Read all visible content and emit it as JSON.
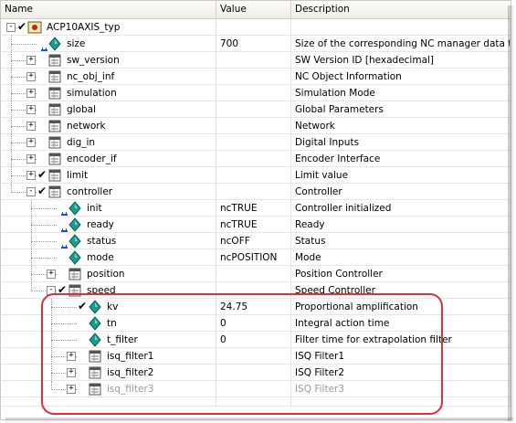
{
  "columns": {
    "name": "Name",
    "value": "Value",
    "description": "Description"
  },
  "colors": {
    "highlight": "#d8323c",
    "lock": "#1b54c8",
    "var": "#1a9c8e"
  },
  "rows": [
    {
      "level": 0,
      "name": "ACP10AXIS_typ",
      "value": "",
      "desc": "",
      "expander": "-",
      "check": true,
      "icon": "struct-check-icon",
      "lock": false
    },
    {
      "level": 1,
      "name": "size",
      "value": "700",
      "desc": "Size of the corresponding NC manager data type",
      "expander": "",
      "check": false,
      "icon": "variable-icon",
      "lock": true
    },
    {
      "level": 1,
      "name": "sw_version",
      "value": "",
      "desc": "SW Version ID [hexadecimal]",
      "expander": "+",
      "check": false,
      "icon": "struct-icon",
      "lock": false
    },
    {
      "level": 1,
      "name": "nc_obj_inf",
      "value": "",
      "desc": "NC Object Information",
      "expander": "+",
      "check": false,
      "icon": "struct-icon",
      "lock": false
    },
    {
      "level": 1,
      "name": "simulation",
      "value": "",
      "desc": "Simulation Mode",
      "expander": "+",
      "check": false,
      "icon": "struct-icon",
      "lock": false
    },
    {
      "level": 1,
      "name": "global",
      "value": "",
      "desc": "Global Parameters",
      "expander": "+",
      "check": false,
      "icon": "struct-icon",
      "lock": false
    },
    {
      "level": 1,
      "name": "network",
      "value": "",
      "desc": "Network",
      "expander": "+",
      "check": false,
      "icon": "struct-icon",
      "lock": false
    },
    {
      "level": 1,
      "name": "dig_in",
      "value": "",
      "desc": "Digital Inputs",
      "expander": "+",
      "check": false,
      "icon": "struct-icon",
      "lock": false
    },
    {
      "level": 1,
      "name": "encoder_if",
      "value": "",
      "desc": "Encoder Interface",
      "expander": "+",
      "check": false,
      "icon": "struct-icon",
      "lock": false
    },
    {
      "level": 1,
      "name": "limit",
      "value": "",
      "desc": "Limit value",
      "expander": "+",
      "check": true,
      "icon": "struct-icon",
      "lock": false
    },
    {
      "level": 1,
      "name": "controller",
      "value": "",
      "desc": "Controller",
      "expander": "-",
      "check": true,
      "icon": "struct-icon",
      "lock": false
    },
    {
      "level": 2,
      "name": "init",
      "value": "ncTRUE",
      "desc": "Controller initialized",
      "expander": "",
      "check": false,
      "icon": "variable-icon",
      "lock": true
    },
    {
      "level": 2,
      "name": "ready",
      "value": "ncTRUE",
      "desc": "Ready",
      "expander": "",
      "check": false,
      "icon": "variable-icon",
      "lock": true
    },
    {
      "level": 2,
      "name": "status",
      "value": "ncOFF",
      "desc": "Status",
      "expander": "",
      "check": false,
      "icon": "variable-icon",
      "lock": true
    },
    {
      "level": 2,
      "name": "mode",
      "value": "ncPOSITION",
      "desc": "Mode",
      "expander": "",
      "check": false,
      "icon": "variable-icon",
      "lock": false
    },
    {
      "level": 2,
      "name": "position",
      "value": "",
      "desc": "Position Controller",
      "expander": "+",
      "check": false,
      "icon": "struct-icon",
      "lock": false
    },
    {
      "level": 2,
      "name": "speed",
      "value": "",
      "desc": "Speed Controller",
      "expander": "-",
      "check": true,
      "icon": "struct-icon",
      "lock": false
    },
    {
      "level": 3,
      "name": "kv",
      "value": "24.75",
      "desc": "Proportional amplification",
      "expander": "",
      "check": true,
      "icon": "variable-icon",
      "lock": false
    },
    {
      "level": 3,
      "name": "tn",
      "value": "0",
      "desc": "Integral action time",
      "expander": "",
      "check": false,
      "icon": "variable-icon",
      "lock": false
    },
    {
      "level": 3,
      "name": "t_filter",
      "value": "0",
      "desc": "Filter time for extrapolation filter",
      "expander": "",
      "check": false,
      "icon": "variable-icon",
      "lock": false
    },
    {
      "level": 3,
      "name": "isq_filter1",
      "value": "",
      "desc": "ISQ Filter1",
      "expander": "+",
      "check": false,
      "icon": "struct-icon",
      "lock": false
    },
    {
      "level": 3,
      "name": "isq_filter2",
      "value": "",
      "desc": "ISQ Filter2",
      "expander": "+",
      "check": false,
      "icon": "struct-icon",
      "lock": false
    },
    {
      "level": 3,
      "name": "isq_filter3",
      "value": "",
      "desc": "ISQ Filter3",
      "expander": "+",
      "check": false,
      "icon": "struct-icon",
      "lock": false,
      "dim": true
    }
  ]
}
